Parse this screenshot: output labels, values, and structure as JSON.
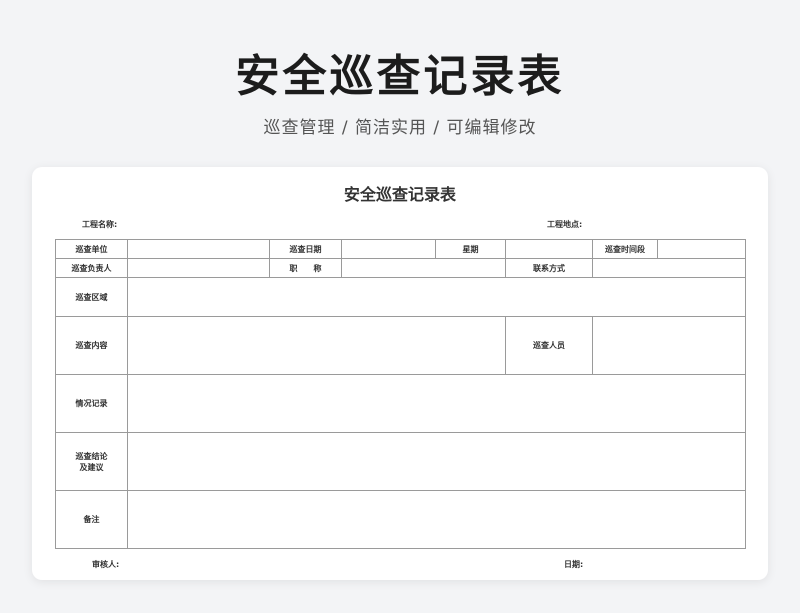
{
  "hero": {
    "title": "安全巡查记录表",
    "subtitle": "巡查管理 / 简洁实用 / 可编辑修改"
  },
  "form": {
    "title": "安全巡查记录表",
    "project_name_label": "工程名称:",
    "project_location_label": "工程地点:",
    "rows": {
      "inspection_unit": "巡查单位",
      "inspection_date": "巡查日期",
      "weekday": "星期",
      "inspection_period": "巡查时间段",
      "person_in_charge": "巡查负责人",
      "job_title": "职　　称",
      "contact": "联系方式",
      "area": "巡查区域",
      "content": "巡查内容",
      "personnel": "巡查人员",
      "record": "情况记录",
      "conclusion_line1": "巡查结论",
      "conclusion_line2": "及建议",
      "remarks": "备注"
    },
    "reviewer_label": "审核人:",
    "date_label": "日期:"
  }
}
